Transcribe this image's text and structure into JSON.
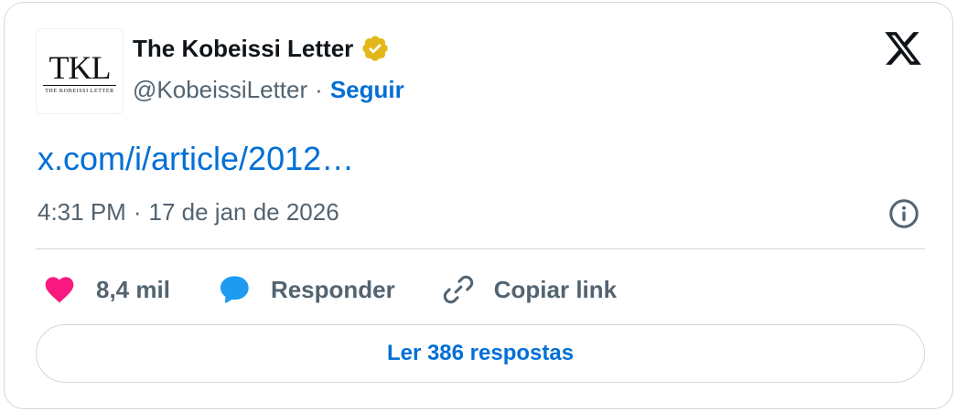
{
  "author": {
    "avatar_monogram": "TKL",
    "avatar_subtitle": "THE KOBEISSI LETTER",
    "name": "The Kobeissi Letter",
    "handle": "@KobeissiLetter",
    "separator": "·",
    "follow_label": "Seguir"
  },
  "post": {
    "link_text": "x.com/i/article/2012…",
    "time": "4:31 PM",
    "separator": "·",
    "date": "17 de jan de 2026"
  },
  "actions": {
    "likes": "8,4 mil",
    "reply_label": "Responder",
    "copy_label": "Copiar link"
  },
  "replies_button": "Ler 386 respostas",
  "colors": {
    "link": "#006fd6",
    "like": "#f91880",
    "reply": "#1d9bf0",
    "verified": "#e2b719",
    "muted": "#536471",
    "border": "#cfd9de"
  },
  "icons": [
    "verified-badge-icon",
    "x-logo-icon",
    "info-icon",
    "heart-icon",
    "speech-bubble-icon",
    "link-icon"
  ]
}
